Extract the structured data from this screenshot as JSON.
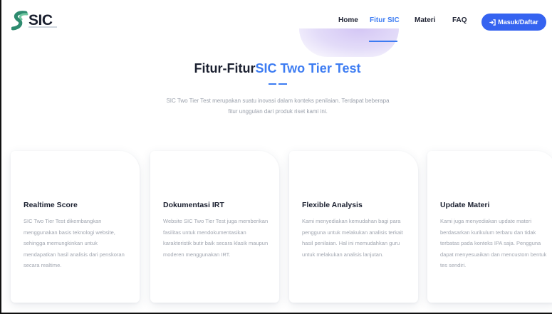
{
  "header": {
    "logo_text": "SIC",
    "nav": [
      "Home",
      "Fitur SIC",
      "Materi",
      "FAQ"
    ],
    "active_nav": "Fitur SIC",
    "login_label": "Masuk/Daftar"
  },
  "hero": {
    "title_prefix": "Fitur-Fitur",
    "title_accent": "SIC Two Tier Test",
    "description": "SIC Two Tier Test merupakan suatu inovasi dalam konteks penilaian. Terdapat beberapa fitur unggulan dari produk riset kami ini."
  },
  "cards": [
    {
      "title": "Realtime Score",
      "text": "SIC Two Tier Test dikembangkan menggunakan basis teknologi website, sehingga memungkinkan untuk mendapatkan hasil analisis dari penskoran secara realtime."
    },
    {
      "title": "Dokumentasi IRT",
      "text": "Website SIC Two Tier Test juga memberikan fasilitas untuk mendokumentasikan karakteristik butir baik secara klasik maupun moderen menggunakan IRT."
    },
    {
      "title": "Flexible Analysis",
      "text": "Kami menyediakan kemudahan bagi para pengguna untuk melakukan analisis terkait hasil penilaian. Hal ini memudahkan guru untuk melakukan analisis lanjutan."
    },
    {
      "title": "Update Materi",
      "text": "Kami juga menyediakan update materi berdasarkan kurikulum terbaru dan tidak terbatas pada konteks IPA saja. Pengguna dapat menyesuaikan dan mencustom bentuk tes sendiri."
    }
  ],
  "colors": {
    "accent": "#3d7cf2",
    "button": "#3563f0",
    "heading": "#1b2030",
    "muted_text": "#a1a6b0"
  }
}
